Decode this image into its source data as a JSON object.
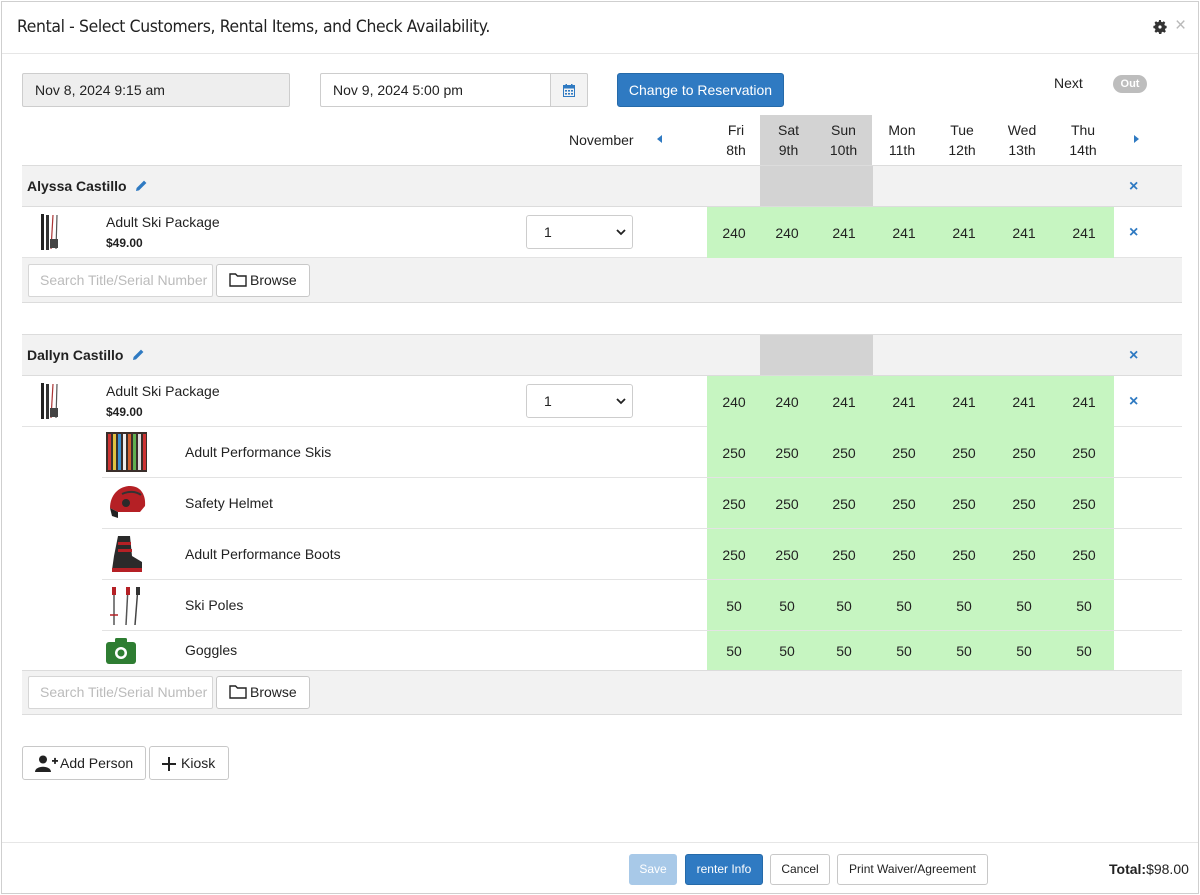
{
  "header": {
    "title": "Rental - Select Customers, Rental Items, and Check Availability.",
    "close": "×"
  },
  "dates": {
    "start": "Nov 8, 2024 9:15 am",
    "end": "Nov 9, 2024 5:00 pm"
  },
  "change_reservation_label": "Change to Reservation",
  "next_label": "Next",
  "toggle_label": "Out",
  "calendar": {
    "month": "November",
    "days": [
      {
        "dow": "Fri",
        "date": "8th",
        "weekend": false
      },
      {
        "dow": "Sat",
        "date": "9th",
        "weekend": true
      },
      {
        "dow": "Sun",
        "date": "10th",
        "weekend": true
      },
      {
        "dow": "Mon",
        "date": "11th",
        "weekend": false
      },
      {
        "dow": "Tue",
        "date": "12th",
        "weekend": false
      },
      {
        "dow": "Wed",
        "date": "13th",
        "weekend": false
      },
      {
        "dow": "Thu",
        "date": "14th",
        "weekend": false
      }
    ]
  },
  "people": [
    {
      "name": "Alyssa Castillo",
      "remove": "×",
      "item": {
        "name": "Adult Ski Package",
        "price": "$49.00",
        "qty": "1",
        "avail": [
          "240",
          "240",
          "241",
          "241",
          "241",
          "241",
          "241"
        ],
        "remove": "×"
      }
    },
    {
      "name": "Dallyn Castillo",
      "remove": "×",
      "item": {
        "name": "Adult Ski Package",
        "price": "$49.00",
        "qty": "1",
        "avail": [
          "240",
          "240",
          "241",
          "241",
          "241",
          "241",
          "241"
        ],
        "remove": "×"
      },
      "components": [
        {
          "name": "Adult Performance Skis",
          "icon": "skis-thumbnail",
          "avail": [
            "250",
            "250",
            "250",
            "250",
            "250",
            "250",
            "250"
          ]
        },
        {
          "name": "Safety Helmet",
          "icon": "helmet-thumbnail",
          "avail": [
            "250",
            "250",
            "250",
            "250",
            "250",
            "250",
            "250"
          ]
        },
        {
          "name": "Adult Performance Boots",
          "icon": "boot-thumbnail",
          "avail": [
            "250",
            "250",
            "250",
            "250",
            "250",
            "250",
            "250"
          ]
        },
        {
          "name": "Ski Poles",
          "icon": "poles-thumbnail",
          "avail": [
            "50",
            "50",
            "50",
            "50",
            "50",
            "50",
            "50"
          ]
        },
        {
          "name": "Goggles",
          "icon": "camera-placeholder-icon",
          "avail": [
            "50",
            "50",
            "50",
            "50",
            "50",
            "50",
            "50"
          ]
        }
      ]
    }
  ],
  "search_placeholder": "Search Title/Serial Number",
  "browse_label": "Browse",
  "add_person_label": "Add Person",
  "kiosk_label": "Kiosk",
  "footer": {
    "save": "Save",
    "renter_info": "renter Info",
    "cancel": "Cancel",
    "print": "Print Waiver/Agreement",
    "total_label": "Total:",
    "total_value": "$98.00"
  },
  "colors": {
    "primary": "#2f7ac2",
    "available": "#c6f5c1",
    "weekend": "#d3d3d3"
  }
}
